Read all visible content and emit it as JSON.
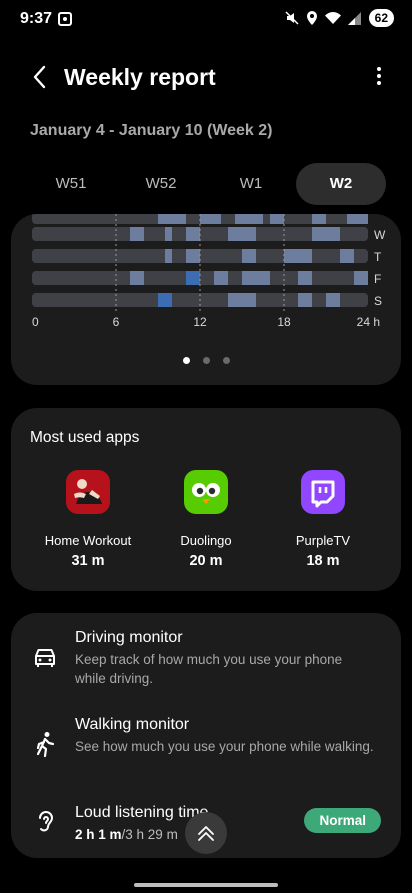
{
  "status_bar": {
    "time": "9:37",
    "battery": "62"
  },
  "header": {
    "title": "Weekly report"
  },
  "date_range": "January 4 - January 10 (Week 2)",
  "week_tabs": [
    {
      "label": "W51",
      "active": false
    },
    {
      "label": "W52",
      "active": false
    },
    {
      "label": "W1",
      "active": false
    },
    {
      "label": "W2",
      "active": true
    }
  ],
  "usage_chart": {
    "days": [
      {
        "label": "",
        "usage": [
          [
            9,
            11
          ],
          [
            12,
            13.5
          ],
          [
            14.5,
            16.5
          ],
          [
            17,
            18
          ],
          [
            20,
            21
          ],
          [
            22.5,
            24
          ]
        ]
      },
      {
        "label": "W",
        "usage": [
          [
            7,
            8
          ],
          [
            9.5,
            10
          ],
          [
            11,
            12
          ],
          [
            14,
            16
          ],
          [
            20,
            22
          ]
        ]
      },
      {
        "label": "T",
        "usage": [
          [
            9.5,
            10
          ],
          [
            11,
            12
          ],
          [
            15,
            16
          ],
          [
            18,
            20
          ],
          [
            22,
            23
          ]
        ]
      },
      {
        "label": "F",
        "usage": [
          [
            7,
            8
          ],
          [
            11,
            12,
            "hl"
          ],
          [
            13,
            14
          ],
          [
            15,
            17
          ],
          [
            19,
            20
          ],
          [
            23,
            24
          ]
        ]
      },
      {
        "label": "S",
        "usage": [
          [
            9,
            10,
            "hl"
          ],
          [
            14,
            16
          ],
          [
            19,
            20
          ],
          [
            21,
            22
          ]
        ]
      }
    ],
    "x_ticks": [
      "0",
      "6",
      "12",
      "18",
      "24 h"
    ],
    "pages": 3,
    "active_page": 0,
    "colors": {
      "track": "#3f4146",
      "usage": "#6d7d9e",
      "highlight": "#3c6db3"
    }
  },
  "most_used": {
    "title": "Most used apps",
    "apps": [
      {
        "name": "Home Workout",
        "time": "31 m",
        "icon": "home-workout-icon"
      },
      {
        "name": "Duolingo",
        "time": "20 m",
        "icon": "duolingo-icon"
      },
      {
        "name": "PurpleTV",
        "time": "18 m",
        "icon": "purpletv-icon"
      }
    ]
  },
  "monitors": [
    {
      "title": "Driving monitor",
      "desc": "Keep track of how much you use your phone while driving.",
      "icon": "car-icon"
    },
    {
      "title": "Walking monitor",
      "desc": "See how much you use your phone while walking.",
      "icon": "walking-icon"
    },
    {
      "title": "Loud listening time",
      "value": "2 h 1 m",
      "value_rest": "/3 h 29 m",
      "badge": "Normal",
      "icon": "ear-icon"
    }
  ]
}
